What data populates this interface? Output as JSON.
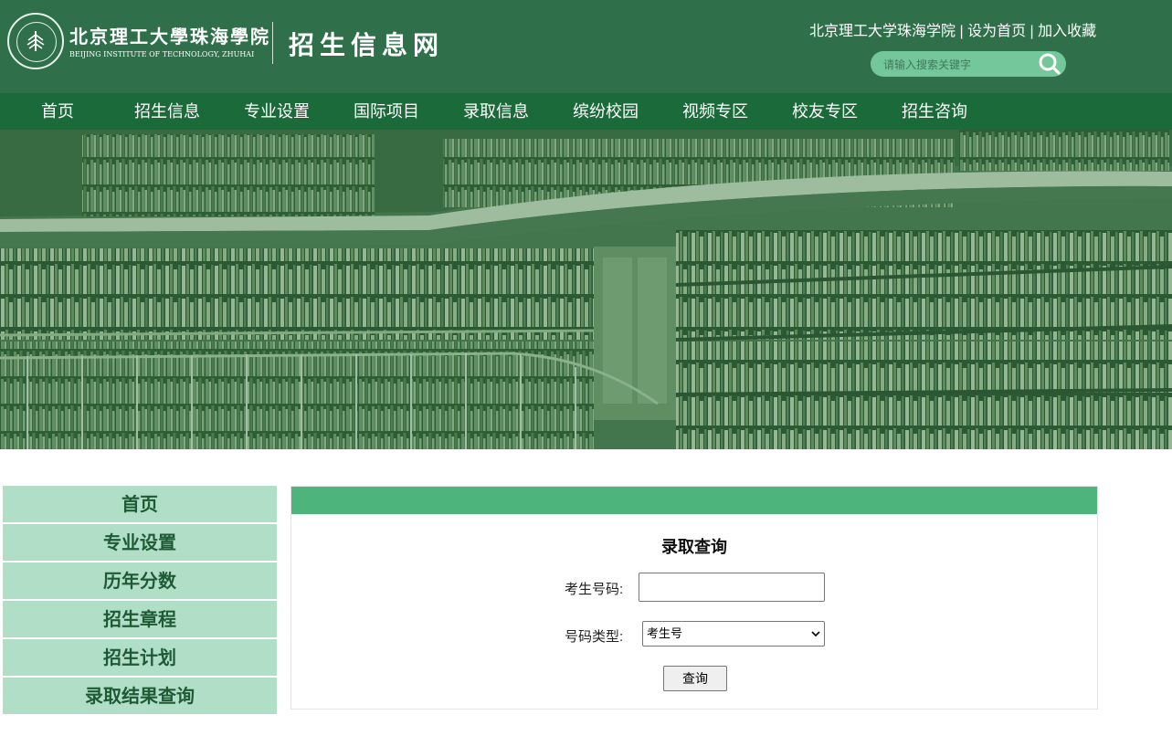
{
  "header": {
    "school_name_cn": "北京理工大學珠海學院",
    "school_name_en": "BEIJING INSTITUTE OF TECHNOLOGY, ZHUHAI",
    "site_title": "招生信息网",
    "top_links": {
      "school": "北京理工大学珠海学院",
      "sep1": " | ",
      "set_home": "设为首页",
      "sep2": " | ",
      "bookmark": "加入收藏"
    },
    "search": {
      "placeholder": "请输入搜索关键字",
      "icon": "search-icon"
    }
  },
  "nav": {
    "items": [
      "首页",
      "招生信息",
      "专业设置",
      "国际项目",
      "录取信息",
      "缤纷校园",
      "视频专区",
      "校友专区",
      "招生咨询"
    ]
  },
  "sidebar": {
    "items": [
      "首页",
      "专业设置",
      "历年分数",
      "招生章程",
      "招生计划",
      "录取结果查询"
    ]
  },
  "query": {
    "title": "录取查询",
    "exam_no_label": "考生号码:",
    "exam_no_value": "",
    "type_label": "号码类型:",
    "type_selected": "考生号",
    "submit_label": "查询"
  },
  "colors": {
    "header_bg": "#2f704a",
    "nav_bg": "#1b6b3a",
    "accent": "#4db57b",
    "sidebar_bg": "#b1dec6"
  }
}
